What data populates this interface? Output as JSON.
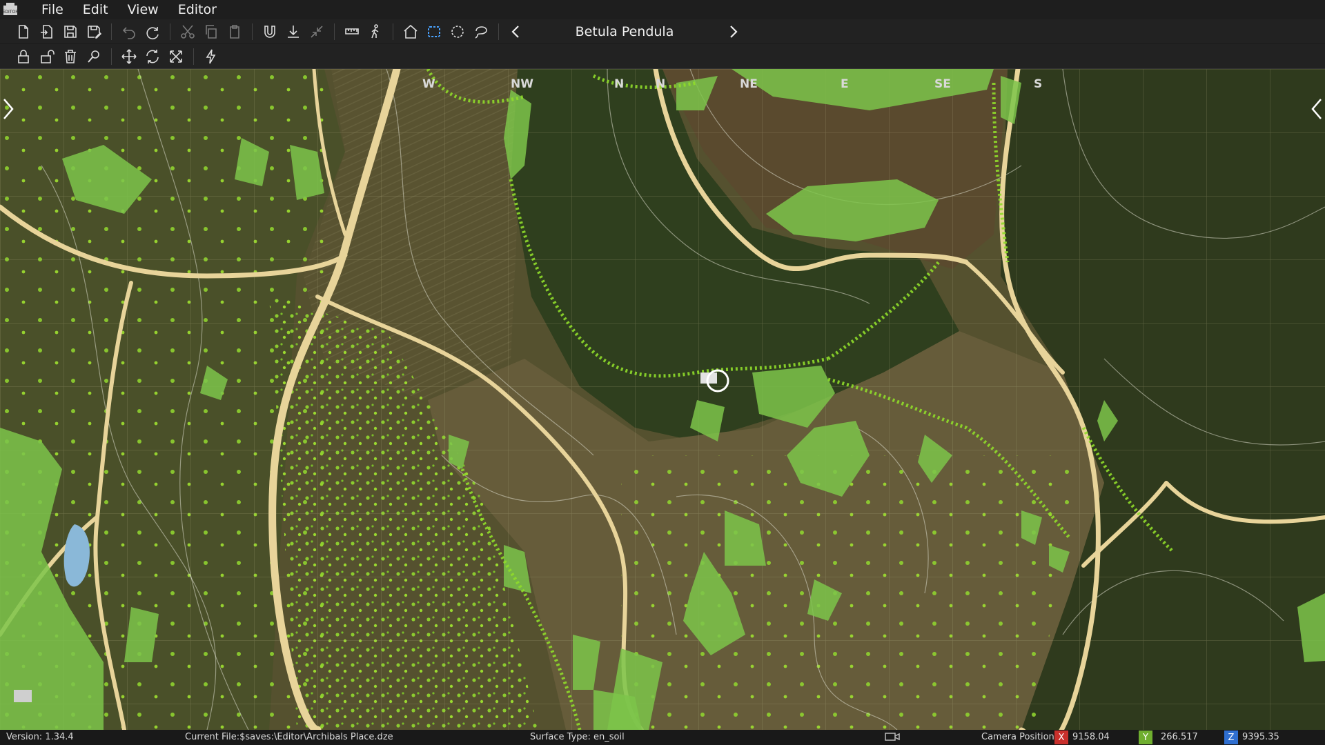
{
  "menu": [
    "File",
    "Edit",
    "View",
    "Editor"
  ],
  "app_logo_text": "EDITOR",
  "toolbar": {
    "selected_object": "Betula Pendula"
  },
  "compass": [
    {
      "label": "W"
    },
    {
      "label": "NW"
    },
    {
      "label": "N"
    },
    {
      "label": "N"
    },
    {
      "label": "NE"
    },
    {
      "label": "E"
    },
    {
      "label": "SE"
    },
    {
      "label": "S"
    }
  ],
  "status": {
    "version": "Version: 1.34.4",
    "current_file": "Current File:$saves:\\Editor\\Archibals Place.dze",
    "surface_type": "Surface Type: en_soil",
    "camera_label": "Camera Position",
    "x_label": "X",
    "x_value": "9158.04",
    "y_label": "Y",
    "y_value": "266.517",
    "z_label": "Z",
    "z_value": "9395.35",
    "x_color": "#c9302c",
    "y_color": "#6fae2f",
    "z_color": "#2f6fd0"
  },
  "colors": {
    "menubar": "#1e1e1e",
    "toolbar": "#222222",
    "accent": "#4aa3ff",
    "vegetation": "#7dc44a"
  }
}
